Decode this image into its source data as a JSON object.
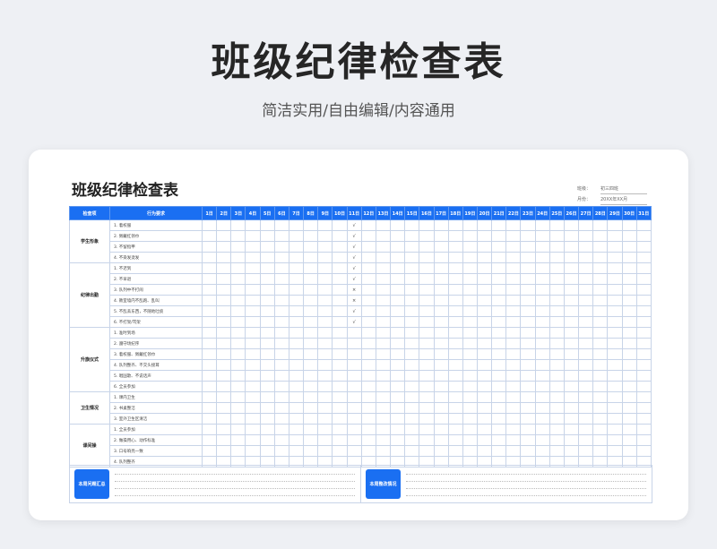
{
  "hero": {
    "title": "班级纪律检查表",
    "subtitle": "简洁实用/自由编辑/内容通用"
  },
  "sheet": {
    "title": "班级纪律检查表",
    "meta": [
      {
        "label": "班级：",
        "value": "初三四班"
      },
      {
        "label": "月份：",
        "value": "20XX年XX月"
      }
    ],
    "header": {
      "category": "检查项",
      "behavior": "行为要求",
      "days": [
        "1日",
        "2日",
        "3日",
        "4日",
        "5日",
        "6日",
        "7日",
        "8日",
        "9日",
        "10日",
        "11日",
        "12日",
        "13日",
        "14日",
        "15日",
        "16日",
        "17日",
        "18日",
        "19日",
        "20日",
        "21日",
        "22日",
        "23日",
        "24日",
        "25日",
        "26日",
        "27日",
        "28日",
        "29日",
        "30日",
        "31日"
      ]
    },
    "groups": [
      {
        "category": "学生形象",
        "items": [
          {
            "text": "1. 着校服",
            "marks": {
              "10": "√"
            }
          },
          {
            "text": "2. 佩戴红领巾",
            "marks": {
              "10": "√"
            }
          },
          {
            "text": "3. 不留指甲",
            "marks": {
              "10": "√"
            }
          },
          {
            "text": "4. 不染发烫发",
            "marks": {
              "10": "√"
            }
          }
        ]
      },
      {
        "category": "纪律出勤",
        "items": [
          {
            "text": "1. 不迟到",
            "marks": {
              "10": "√"
            }
          },
          {
            "text": "2. 不早退",
            "marks": {
              "10": "√"
            }
          },
          {
            "text": "3. 队列中不打闹",
            "marks": {
              "10": "×"
            }
          },
          {
            "text": "4. 教室墙内不乱跑、乱叫",
            "marks": {
              "10": "×"
            }
          },
          {
            "text": "5. 不乱丢东西，不随地吐痰",
            "marks": {
              "10": "√"
            }
          },
          {
            "text": "6. 不打架/骂架",
            "marks": {
              "10": "√"
            }
          }
        ]
      },
      {
        "category": "升旗仪式",
        "items": [
          {
            "text": "1. 准时到场",
            "marks": {}
          },
          {
            "text": "2. 遵守场纪序",
            "marks": {}
          },
          {
            "text": "3. 着校服、佩戴红领巾",
            "marks": {}
          },
          {
            "text": "4. 队列整齐、不交头接耳",
            "marks": {}
          },
          {
            "text": "5. 唱国歌、不说话声",
            "marks": {}
          },
          {
            "text": "6. 全员参加",
            "marks": {}
          }
        ]
      },
      {
        "category": "卫生情况",
        "items": [
          {
            "text": "1. 课内卫生",
            "marks": {}
          },
          {
            "text": "2. 书桌整洁",
            "marks": {}
          },
          {
            "text": "3. 室外卫生区清洁",
            "marks": {}
          }
        ]
      },
      {
        "category": "课间操",
        "items": [
          {
            "text": "1. 全员参加",
            "marks": {}
          },
          {
            "text": "2. 做操用心、动作标准",
            "marks": {}
          },
          {
            "text": "3. 口号响亮一致",
            "marks": {}
          },
          {
            "text": "4. 队列整齐",
            "marks": {}
          }
        ]
      }
    ],
    "footer": {
      "left_label": "本周问题汇总",
      "right_label": "本周整改情况"
    }
  },
  "colors": {
    "accent": "#1a6ff2",
    "grid": "#c8d4e8"
  }
}
